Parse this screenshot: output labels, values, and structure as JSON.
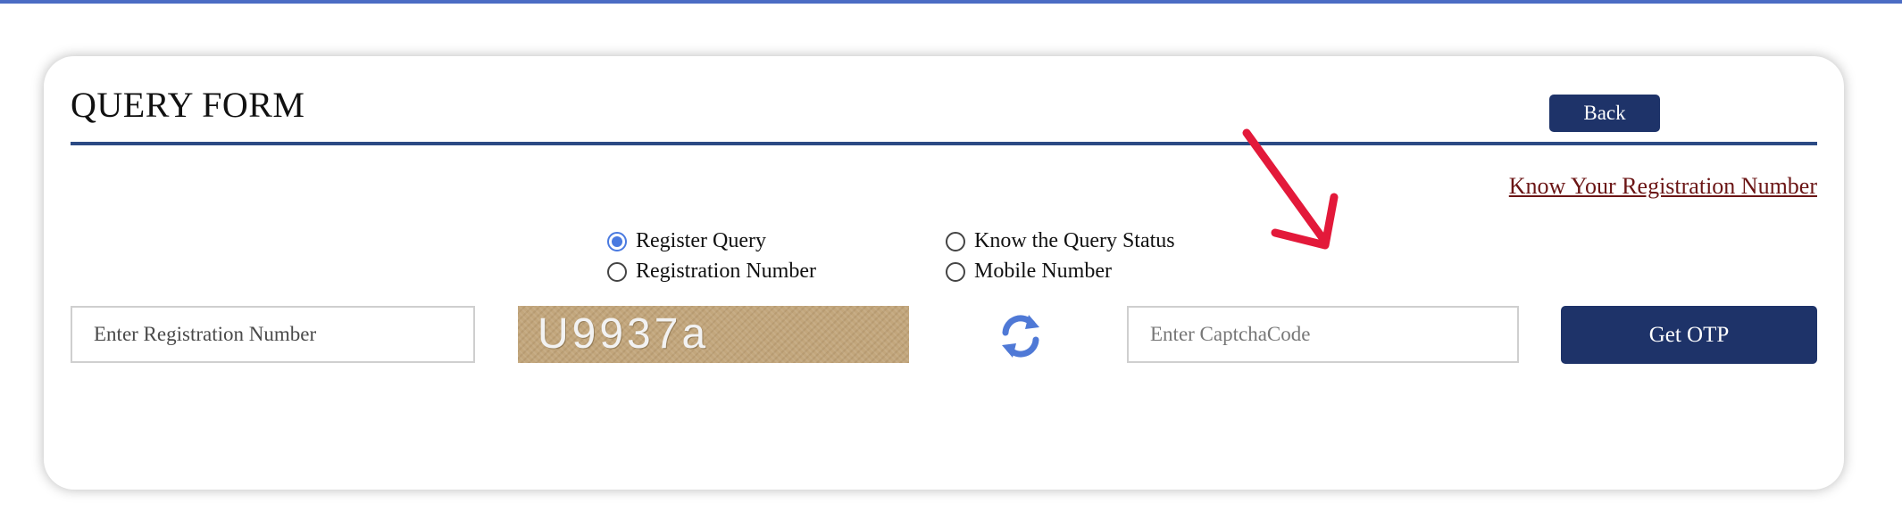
{
  "form": {
    "title": "QUERY FORM",
    "back_label": "Back",
    "know_link": "Know Your Registration Number"
  },
  "options": {
    "register_query": "Register Query",
    "know_status": "Know the Query Status",
    "registration_number": "Registration Number",
    "mobile_number": "Mobile Number",
    "selected": "Register Query"
  },
  "inputs": {
    "registration_placeholder": "Enter Registration Number",
    "captcha_placeholder": "Enter CaptchaCode",
    "registration_value": "",
    "captcha_value": ""
  },
  "captcha": {
    "text": "U9937a"
  },
  "actions": {
    "get_otp_label": "Get OTP"
  },
  "colors": {
    "accent": "#1e3369",
    "top_bar": "#4b6cc4",
    "link": "#6b1515",
    "annotation_arrow": "#e3193a"
  },
  "icons": {
    "refresh": "refresh-icon",
    "annotation": "red-arrow-icon"
  }
}
